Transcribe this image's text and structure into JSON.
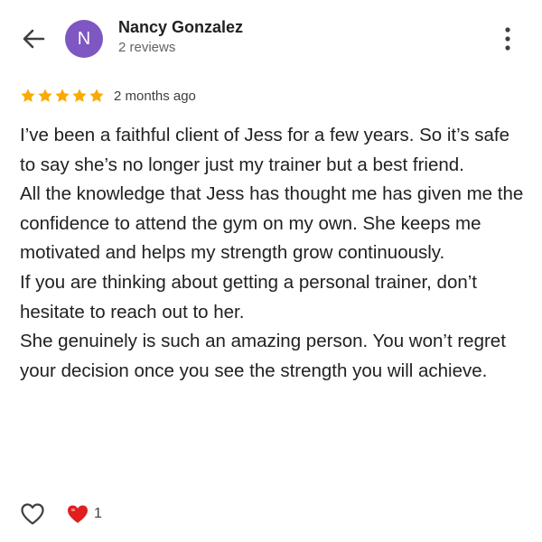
{
  "header": {
    "avatar_letter": "N",
    "avatar_color": "#7e57c2",
    "name": "Nancy Gonzalez",
    "reviews": "2 reviews"
  },
  "rating": {
    "stars": 5,
    "max_stars": 5,
    "star_color": "#f9ab00",
    "time": "2 months ago"
  },
  "review": {
    "paragraphs": [
      "I’ve been a faithful client of Jess for a few years. So it’s safe to say she’s no longer just my trainer but a best friend.",
      "All the knowledge that Jess has thought me has given me the confidence to attend the gym on my own. She keeps me motivated and helps my strength grow continuously.",
      "If you are thinking about getting a personal trainer, don’t hesitate to reach out to her.",
      "She genuinely is such an amazing person. You won’t regret your decision once you see the strength you will achieve."
    ]
  },
  "reactions": {
    "love_count": "1",
    "love_color": "#e01e1e"
  },
  "icons": {
    "back": "back-arrow-icon",
    "more": "more-vert-icon",
    "star": "star-icon",
    "like": "heart-outline-icon",
    "love": "heart-filled-icon"
  }
}
